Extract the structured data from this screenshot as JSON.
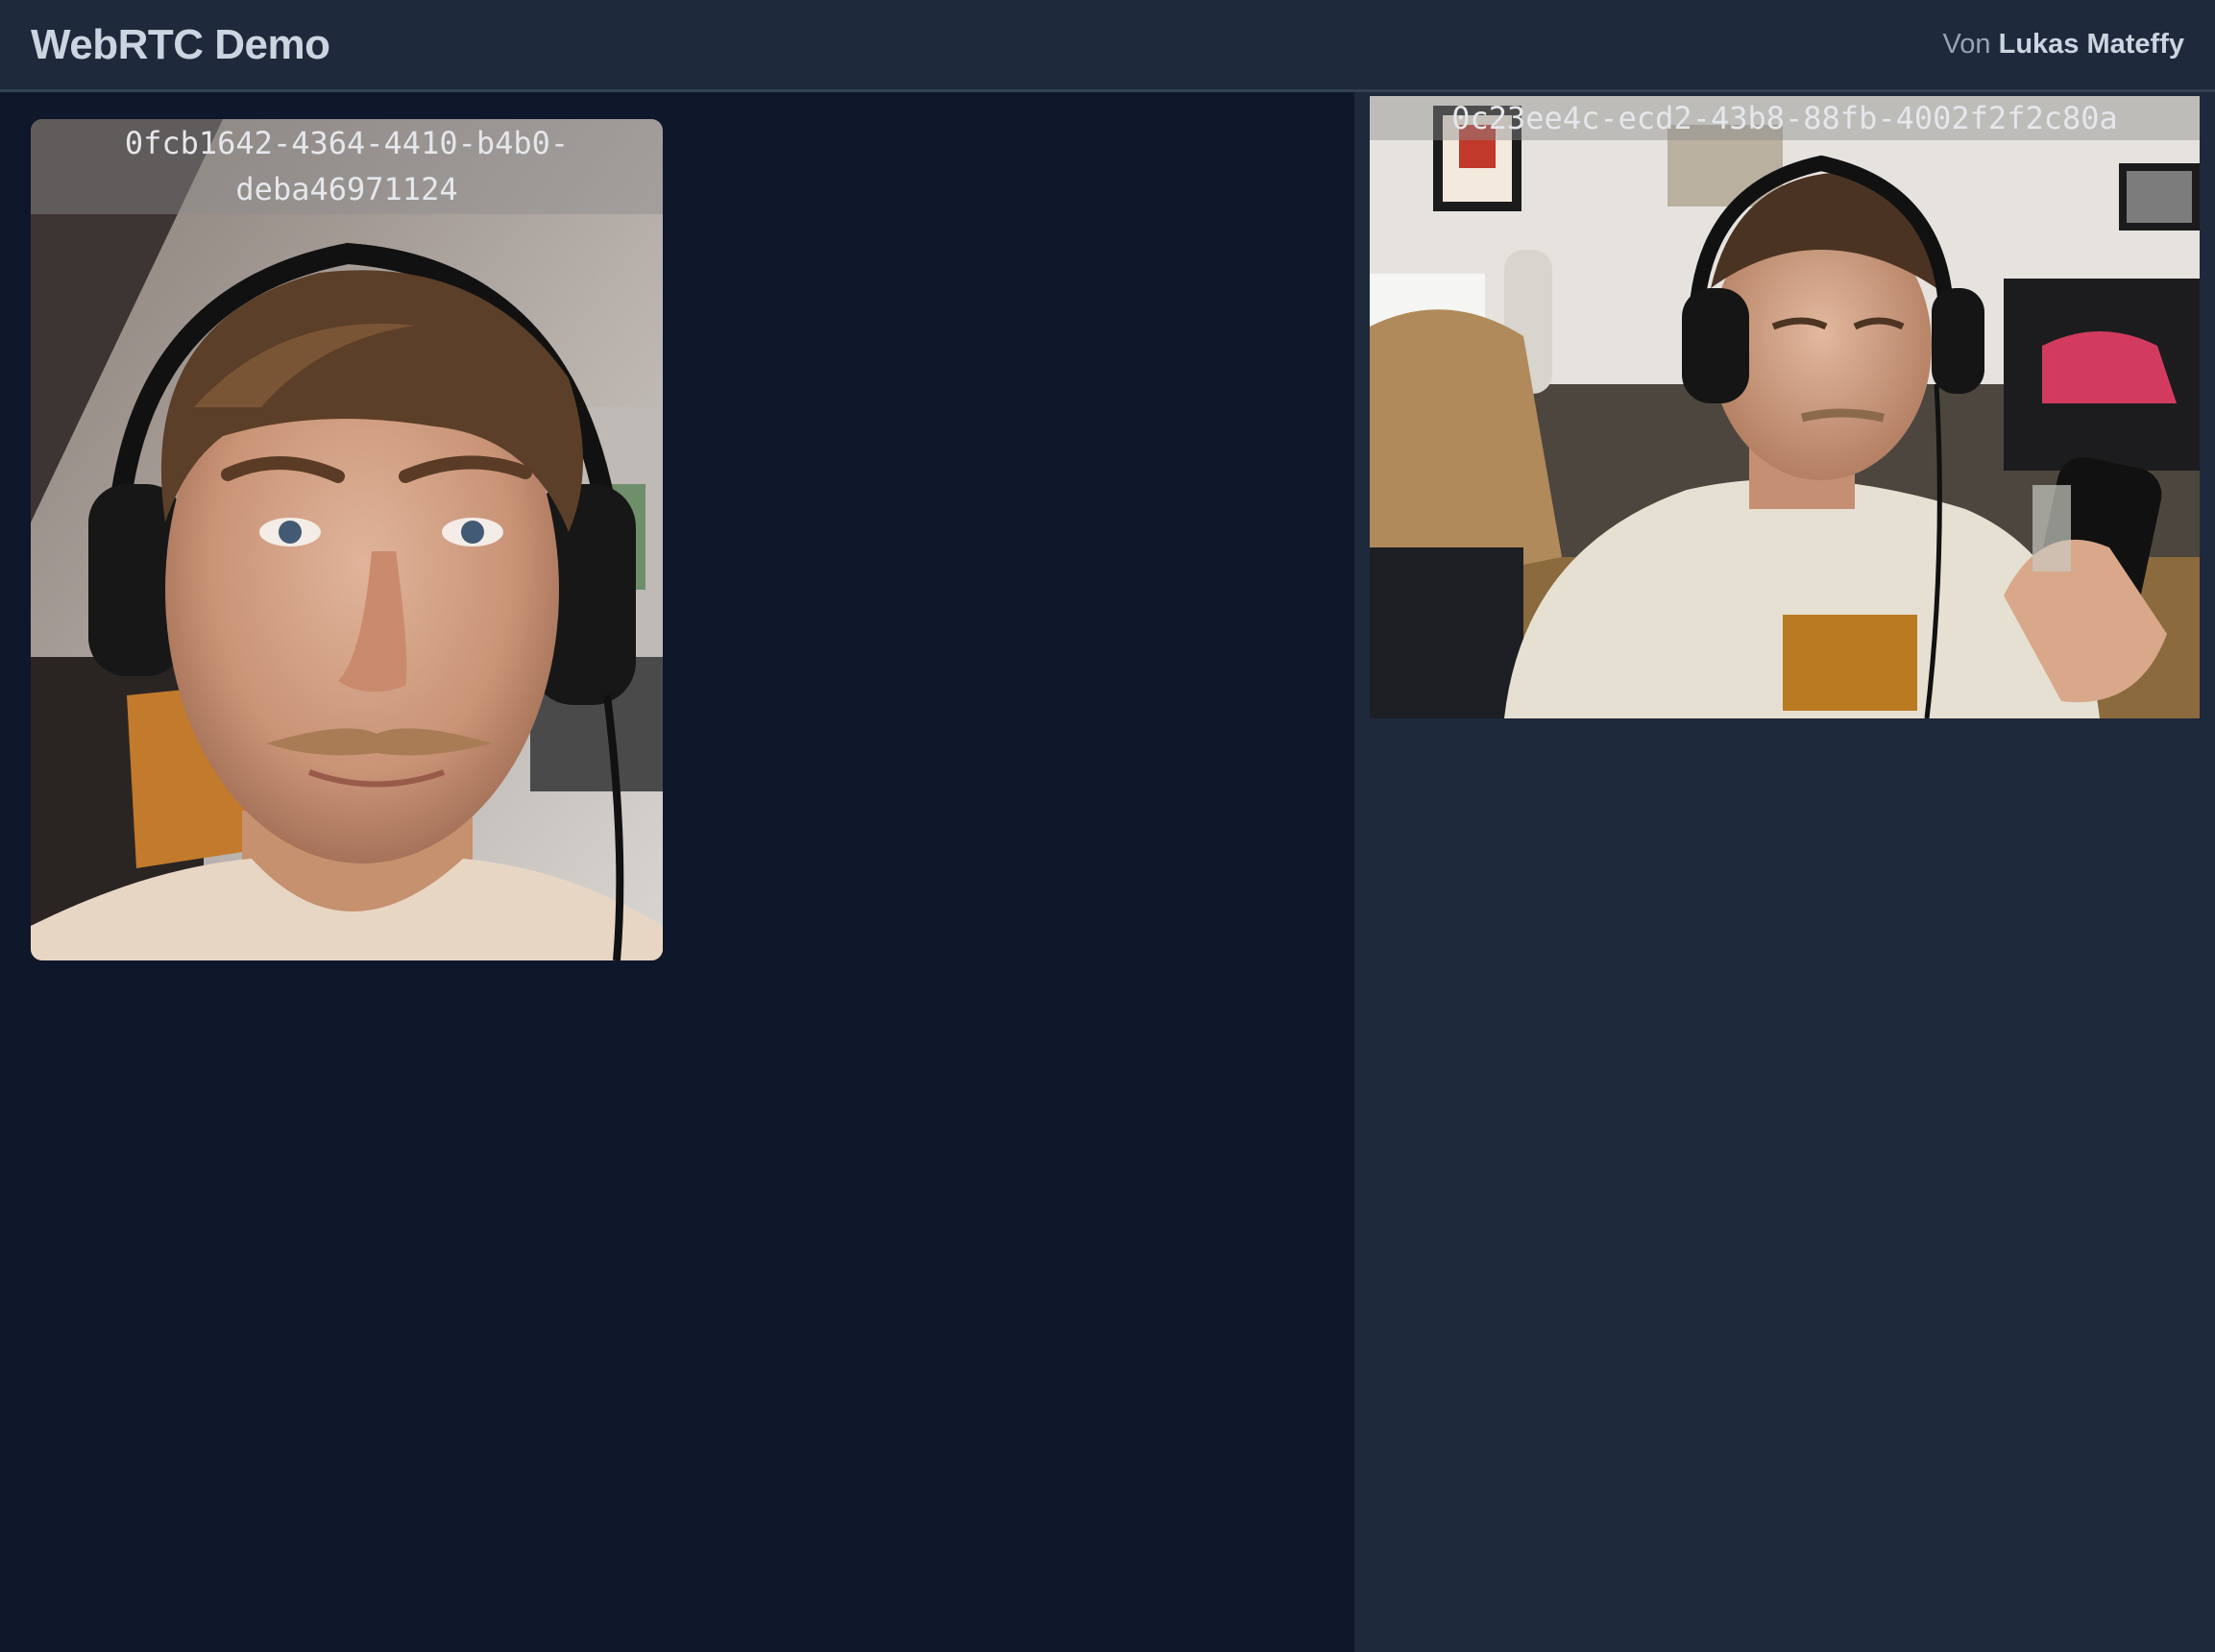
{
  "header": {
    "title": "WebRTC Demo",
    "byline_prefix": "Von",
    "byline_author": "Lukas Mateffy"
  },
  "videos": {
    "local": {
      "peer_id": "0fcb1642-4364-4410-b4b0-deba46971124"
    },
    "remote": {
      "peer_id": "0c23ee4c-ecd2-43b8-88fb-4002f2f2c80a"
    }
  },
  "colors": {
    "header_bg": "#1e293b",
    "main_bg": "#0f172a",
    "sidebar_bg": "#1e293b",
    "title_text": "#cbd5e1",
    "byline_text": "#94a3b8"
  }
}
